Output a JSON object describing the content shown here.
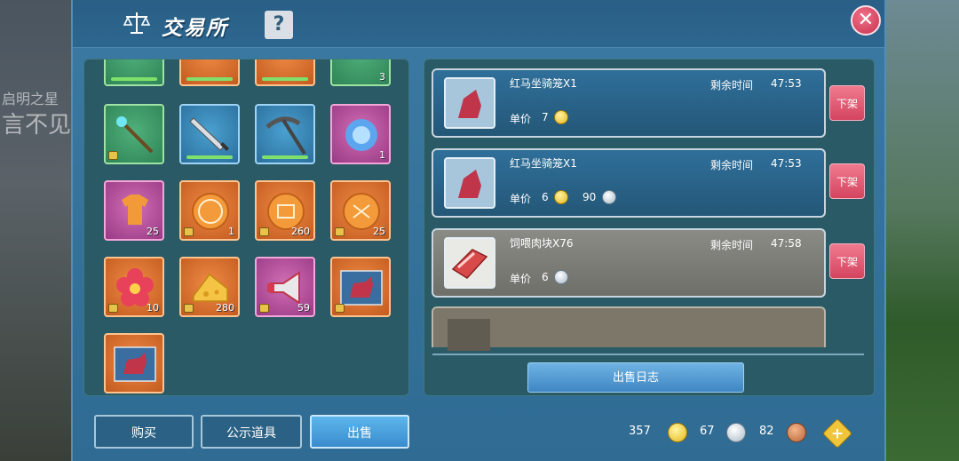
{
  "background_text": {
    "line1": "启明之星",
    "line2": "言不见"
  },
  "header": {
    "title": "交易所",
    "help_label": "?",
    "close_label": "✕"
  },
  "inventory": {
    "slots": [
      {
        "id": "top1",
        "color": "green",
        "icon": "wand-icon",
        "count": ""
      },
      {
        "id": "top2",
        "color": "orange",
        "icon": "coin-icon",
        "count": ""
      },
      {
        "id": "top3",
        "color": "orange",
        "icon": "coin-icon",
        "count": ""
      },
      {
        "id": "top4",
        "color": "green",
        "icon": "item-icon",
        "count": "3"
      },
      {
        "id": "r1c1",
        "color": "green",
        "icon": "staff-icon",
        "count": ""
      },
      {
        "id": "r1c2",
        "color": "blue",
        "icon": "sword-icon",
        "count": ""
      },
      {
        "id": "r1c3",
        "color": "blue",
        "icon": "pickaxe-icon",
        "count": ""
      },
      {
        "id": "r1c4",
        "color": "pink",
        "icon": "orb-icon",
        "count": "1"
      },
      {
        "id": "r2c1",
        "color": "pink",
        "icon": "shirt-icon",
        "count": "25"
      },
      {
        "id": "r2c2",
        "color": "orange",
        "icon": "coin-icon",
        "count": "1"
      },
      {
        "id": "r2c3",
        "color": "orange",
        "icon": "coin-icon",
        "count": "260"
      },
      {
        "id": "r2c4",
        "color": "orange",
        "icon": "coin-icon",
        "count": "25"
      },
      {
        "id": "r3c1",
        "color": "orange",
        "icon": "flower-icon",
        "count": "10"
      },
      {
        "id": "r3c2",
        "color": "orange",
        "icon": "cheese-icon",
        "count": "280"
      },
      {
        "id": "r3c3",
        "color": "pink",
        "icon": "megaphone-icon",
        "count": "59"
      },
      {
        "id": "r3c4",
        "color": "orange",
        "icon": "horse-card-icon",
        "count": ""
      },
      {
        "id": "r4c1",
        "color": "orange",
        "icon": "horse-card-icon",
        "count": ""
      }
    ]
  },
  "listings": [
    {
      "name": "红马坐骑笼X1",
      "time_label": "剩余时间",
      "time": "47:53",
      "price_label": "单价",
      "price_gold": "7",
      "price_silver": "",
      "delist_label": "下架"
    },
    {
      "name": "红马坐骑笼X1",
      "time_label": "剩余时间",
      "time": "47:53",
      "price_label": "单价",
      "price_gold": "6",
      "price_silver": "90",
      "delist_label": "下架"
    },
    {
      "name": "饲喂肉块X76",
      "time_label": "剩余时间",
      "time": "47:58",
      "price_label": "单价",
      "price_gold": "",
      "price_silver": "6",
      "delist_label": "下架"
    }
  ],
  "log_button": "出售日志",
  "tabs": {
    "buy": "购买",
    "public": "公示道具",
    "sell": "出售"
  },
  "currency": {
    "gold": "357",
    "silver": "67",
    "copper": "82"
  },
  "colors": {
    "panel": "#2f6b93",
    "accent": "#3a8ccd",
    "delist": "#d4445f"
  }
}
